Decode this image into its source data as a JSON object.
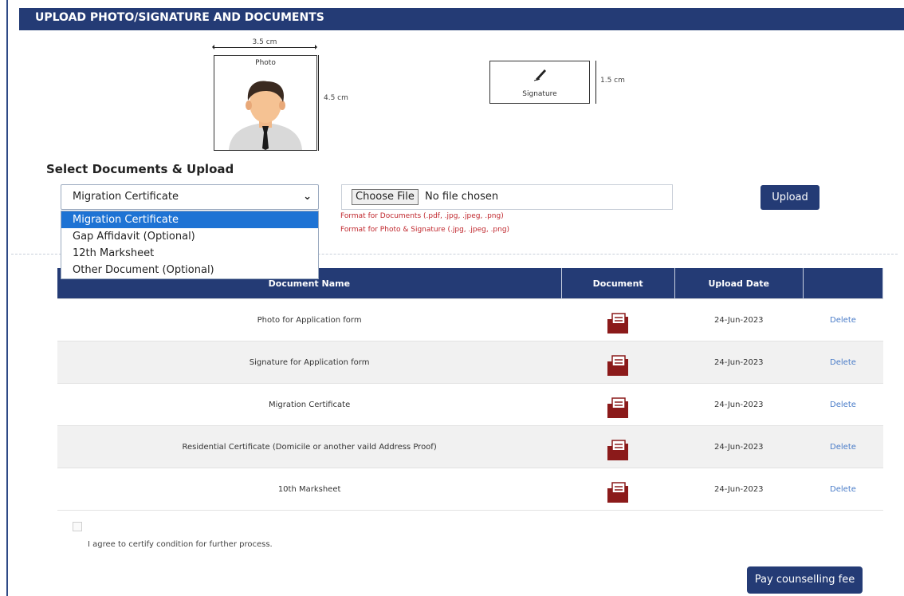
{
  "header": {
    "title": "UPLOAD PHOTO/SIGNATURE AND DOCUMENTS"
  },
  "photo_spec": {
    "label": "Photo",
    "width_label": "3.5 cm",
    "height_label": "4.5 cm"
  },
  "signature_spec": {
    "label": "Signature",
    "height_label": "1.5 cm"
  },
  "upload_section": {
    "title": "Select Documents & Upload",
    "selected_document": "Migration Certificate",
    "dropdown_options": [
      "Migration Certificate",
      "Gap Affidavit (Optional)",
      "12th Marksheet",
      "Other Document (Optional)"
    ],
    "choose_file_label": "Choose File",
    "file_status": "No file chosen",
    "format_docs": "Format for Documents (.pdf, .jpg, .jpeg, .png)",
    "format_photo": "Format for Photo & Signature (.jpg, .jpeg, .png)",
    "upload_button": "Upload"
  },
  "table": {
    "headers": [
      "Document Name",
      "Document",
      "Upload Date",
      ""
    ],
    "rows": [
      {
        "name": "Photo for Application form",
        "date": "24-Jun-2023",
        "action": "Delete"
      },
      {
        "name": "Signature for Application form",
        "date": "24-Jun-2023",
        "action": "Delete"
      },
      {
        "name": "Migration Certificate",
        "date": "24-Jun-2023",
        "action": "Delete"
      },
      {
        "name": "Residential Certificate (Domicile or another vaild Address Proof)",
        "date": "24-Jun-2023",
        "action": "Delete"
      },
      {
        "name": "10th Marksheet",
        "date": "24-Jun-2023",
        "action": "Delete"
      }
    ]
  },
  "agreement": {
    "text": "I agree to certify condition for further process.",
    "checked": false
  },
  "pay_button": "Pay counselling fee",
  "colors": {
    "primary": "#243b75",
    "format_text": "#c0282e",
    "delete_link": "#4a7cc8",
    "doc_icon": "#8b1a1a",
    "dropdown_selected": "#1e73d4"
  }
}
